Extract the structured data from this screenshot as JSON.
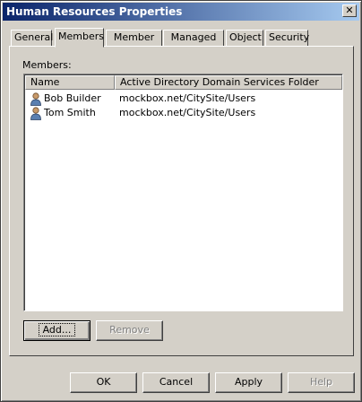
{
  "window": {
    "title": "Human Resources Properties",
    "close_glyph": "✕"
  },
  "tabs": [
    {
      "label": "General"
    },
    {
      "label": "Members"
    },
    {
      "label": "Member Of"
    },
    {
      "label": "Managed By"
    },
    {
      "label": "Object"
    },
    {
      "label": "Security"
    }
  ],
  "active_tab": "Members",
  "members": {
    "label": "Members:",
    "columns": [
      "Name",
      "Active Directory Domain Services Folder"
    ],
    "rows": [
      {
        "name": "Bob Builder",
        "folder": "mockbox.net/CitySite/Users",
        "icon": "user-icon"
      },
      {
        "name": "Tom Smith",
        "folder": "mockbox.net/CitySite/Users",
        "icon": "user-icon"
      }
    ]
  },
  "buttons": {
    "add": "Add...",
    "remove": "Remove",
    "ok": "OK",
    "cancel": "Cancel",
    "apply": "Apply",
    "help": "Help"
  },
  "colors": {
    "titlebar_start": "#0a246a",
    "titlebar_end": "#a6caf0",
    "face": "#d4d0c8"
  }
}
